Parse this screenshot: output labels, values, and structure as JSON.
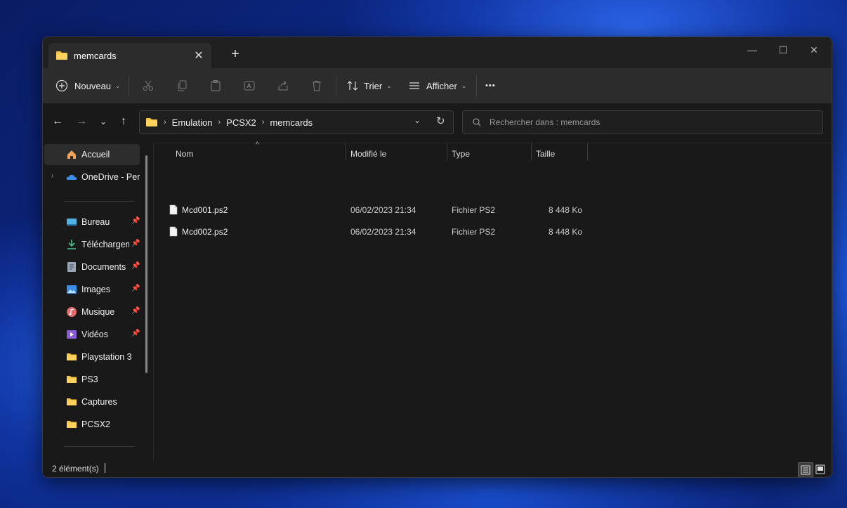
{
  "tab": {
    "title": "memcards",
    "close": "✕",
    "new": "+"
  },
  "window_controls": {
    "minimize": "—",
    "maximize": "☐",
    "close": "✕"
  },
  "toolbar": {
    "new_label": "Nouveau",
    "sort_label": "Trier",
    "view_label": "Afficher",
    "more": "•••"
  },
  "address": {
    "crumbs": [
      "Emulation",
      "PCSX2",
      "memcards"
    ],
    "sep": "›"
  },
  "search": {
    "placeholder": "Rechercher dans : memcards"
  },
  "sidebar": {
    "items": [
      {
        "label": "Accueil"
      },
      {
        "label": "OneDrive - Personnel"
      },
      {
        "label": "Bureau"
      },
      {
        "label": "Téléchargements"
      },
      {
        "label": "Documents"
      },
      {
        "label": "Images"
      },
      {
        "label": "Musique"
      },
      {
        "label": "Vidéos"
      },
      {
        "label": "Playstation 3"
      },
      {
        "label": "PS3"
      },
      {
        "label": "Captures"
      },
      {
        "label": "PCSX2"
      }
    ]
  },
  "columns": {
    "name": "Nom",
    "modified": "Modifié le",
    "type": "Type",
    "size": "Taille"
  },
  "files": [
    {
      "name": "Mcd001.ps2",
      "modified": "06/02/2023 21:34",
      "type": "Fichier PS2",
      "size": "8 448 Ko"
    },
    {
      "name": "Mcd002.ps2",
      "modified": "06/02/2023 21:34",
      "type": "Fichier PS2",
      "size": "8 448 Ko"
    }
  ],
  "status": {
    "count": "2 élément(s)"
  },
  "colors": {
    "folder": "#f5c542",
    "accent": "#4aa3ff"
  }
}
